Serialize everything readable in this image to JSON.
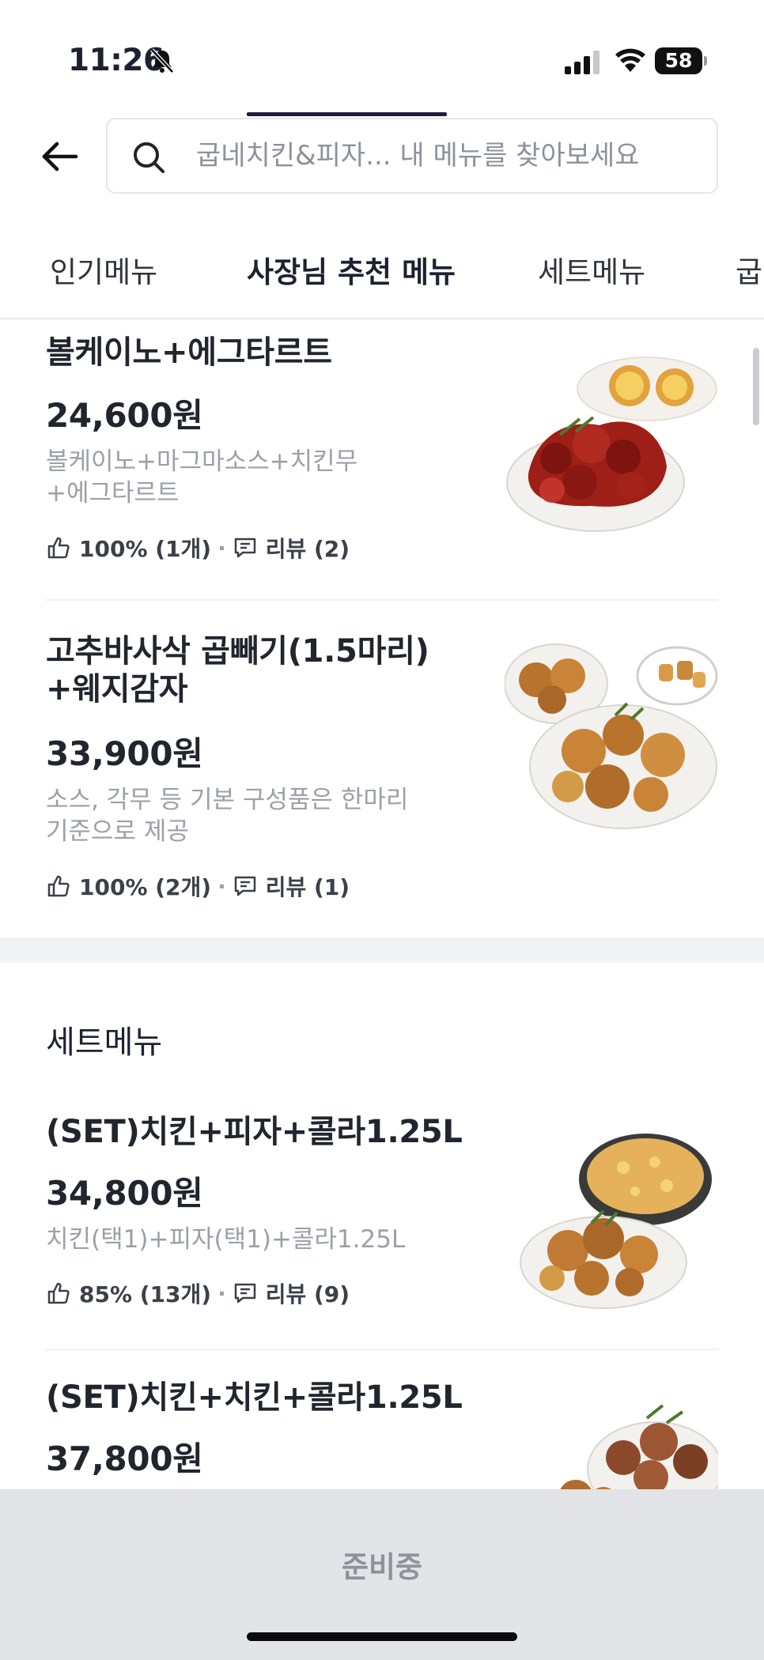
{
  "status_bar": {
    "time": "11:26",
    "battery": "58",
    "battery_fraction": 0.58
  },
  "search": {
    "placeholder": "굽네치킨&피자...  내 메뉴를 찾아보세요"
  },
  "tabs": [
    {
      "label": "인기메뉴"
    },
    {
      "label": "사장님 추천 메뉴",
      "active": true
    },
    {
      "label": "세트메뉴"
    },
    {
      "label": "굽"
    }
  ],
  "items": [
    {
      "title": "볼케이노+에그타르트",
      "price": "24,600원",
      "desc": [
        "볼케이노+마그마소스+치킨무",
        "+에그타르트"
      ],
      "rating": "100% (1개)",
      "reviews": "리뷰 (2)"
    },
    {
      "title": [
        "고추바사삭 곱빼기(1.5마리)",
        "+웨지감자"
      ],
      "price": "33,900원",
      "desc": [
        "소스, 각무 등 기본 구성품은 한마리",
        "기준으로 제공"
      ],
      "rating": "100% (2개)",
      "reviews": "리뷰 (1)"
    }
  ],
  "set_section": {
    "title": "세트메뉴",
    "items": [
      {
        "title": "(SET)치킨+피자+콜라1.25L",
        "price": "34,800원",
        "desc": "치킨(택1)+피자(택1)+콜라1.25L",
        "rating": "85% (13개)",
        "reviews": "리뷰 (9)"
      },
      {
        "title": "(SET)치킨+치킨+콜라1.25L",
        "price": "37,800원"
      }
    ]
  },
  "bottom": {
    "label": "준비중"
  },
  "colors": {
    "accent": "#1c1f3b",
    "muted_text": "#9ba0a8",
    "bottom_bar": "#e2e4e8"
  }
}
